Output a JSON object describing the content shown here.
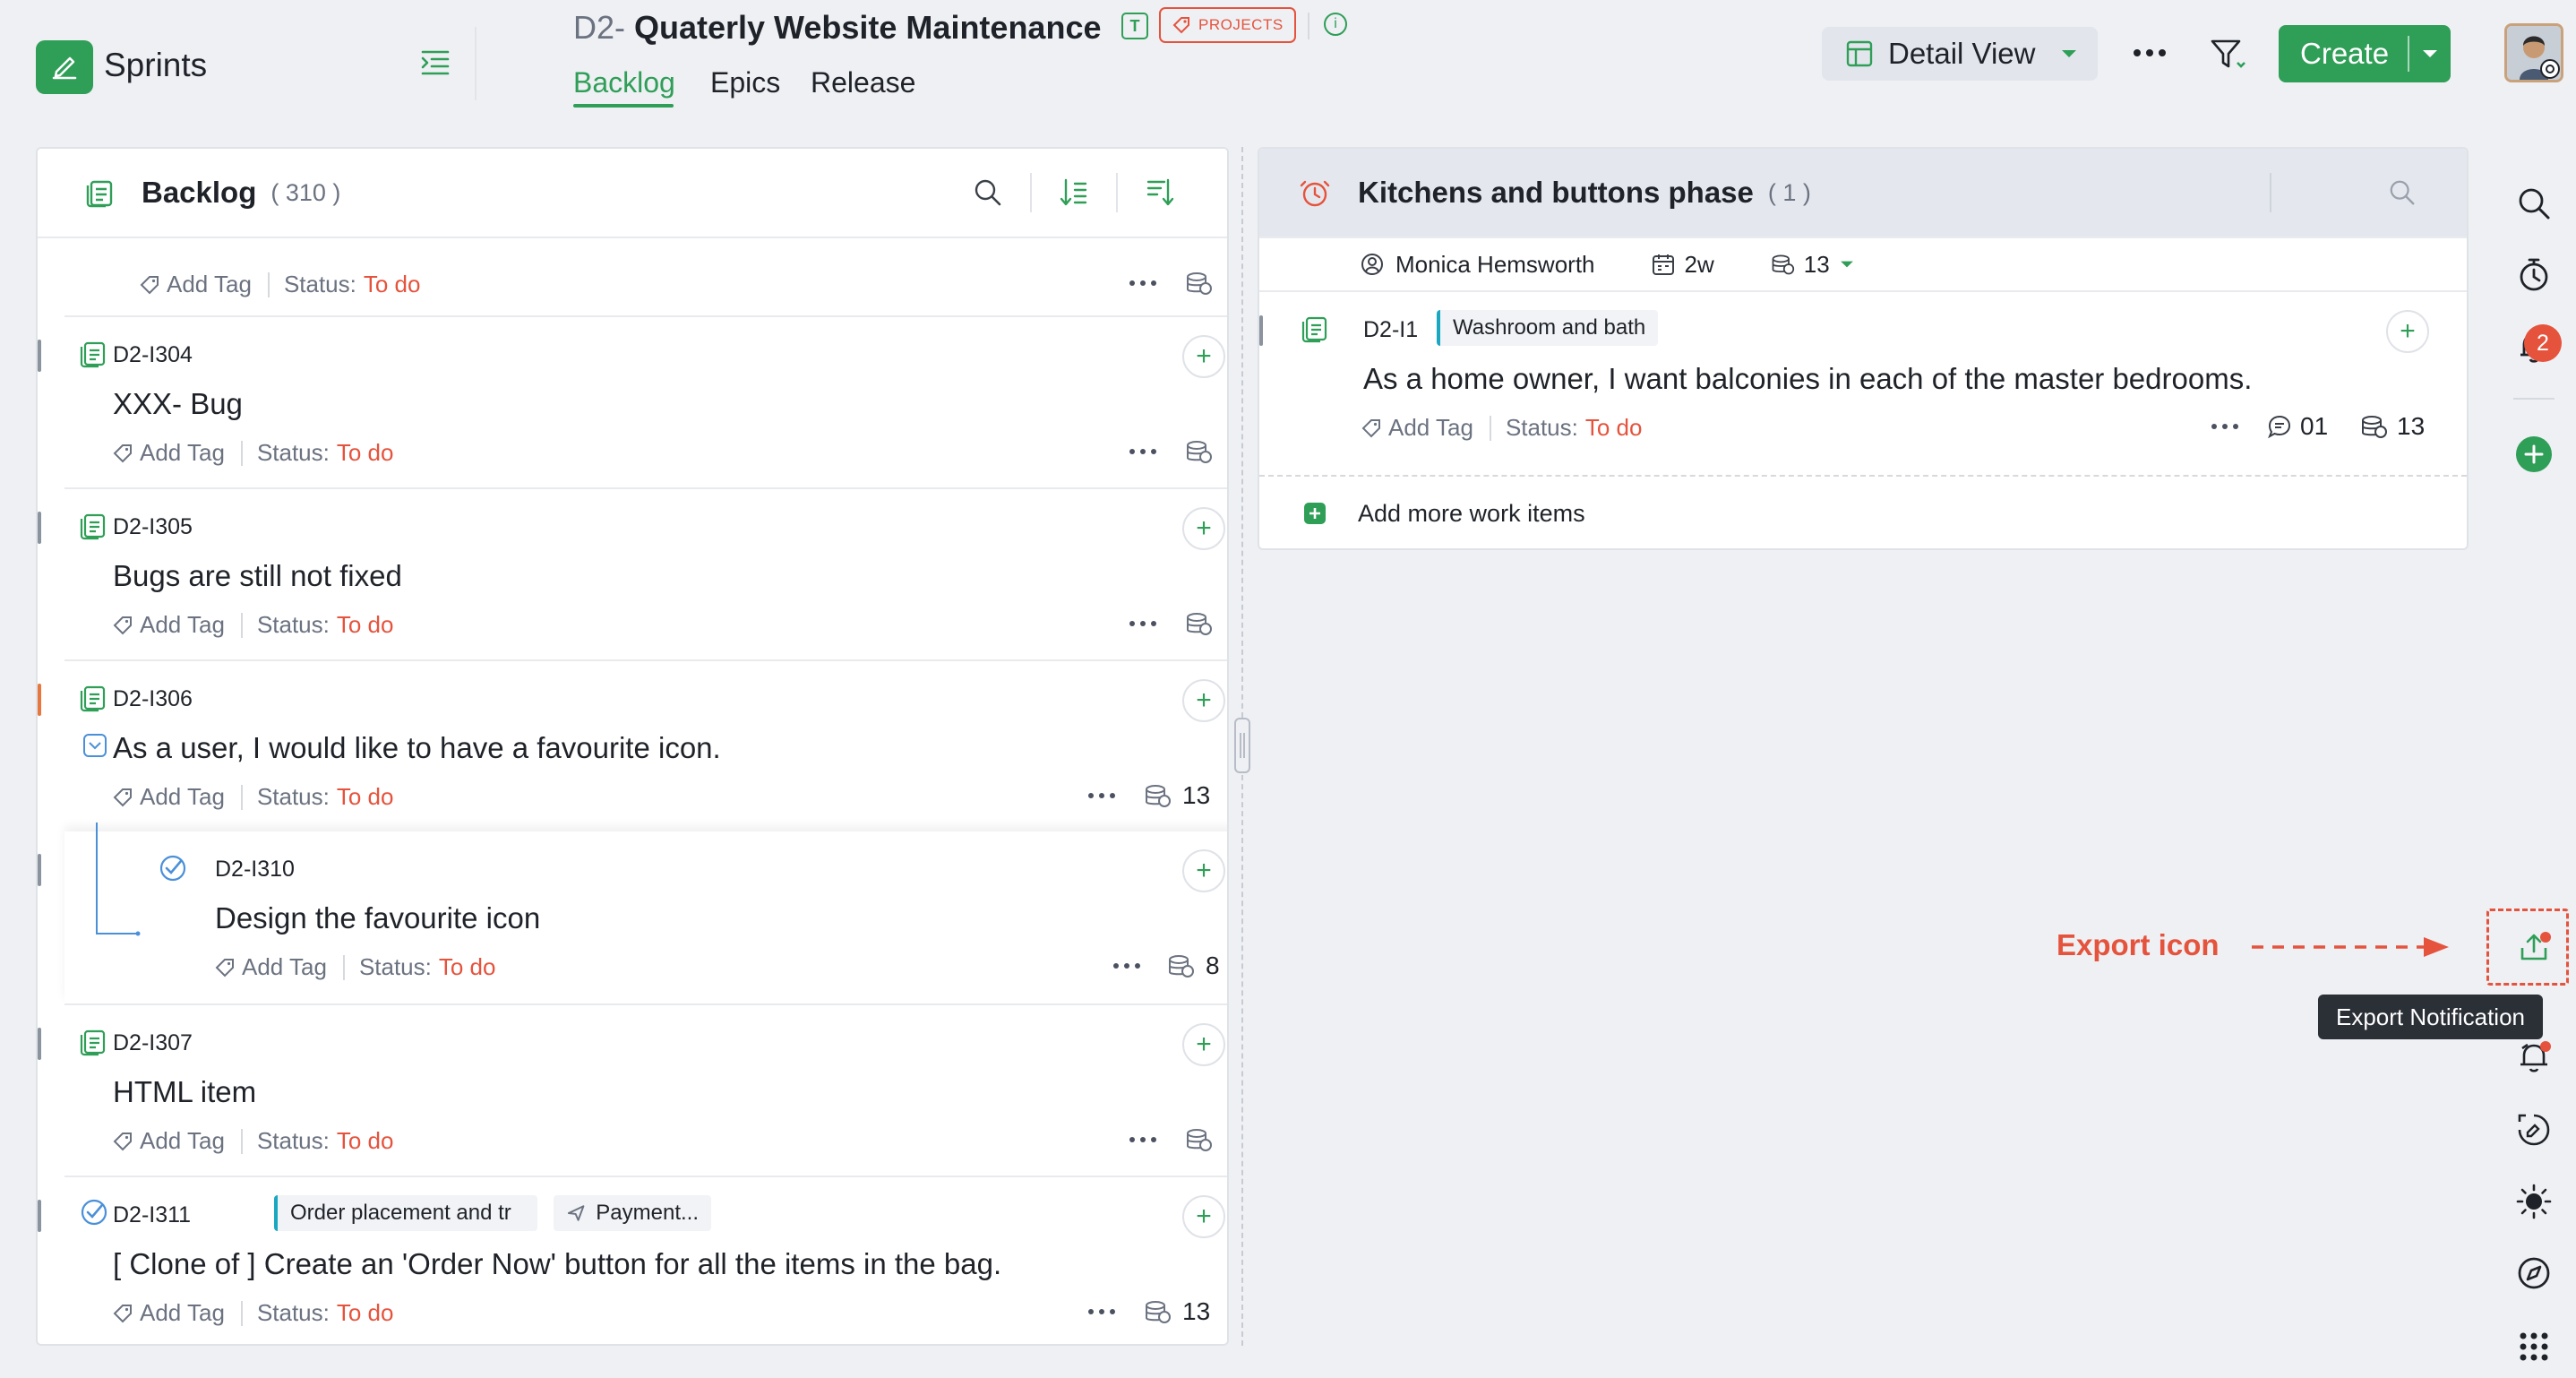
{
  "app": {
    "name": "Sprints"
  },
  "project": {
    "key": "D2-",
    "title": "Quaterly Website Maintenance",
    "type_letter": "T",
    "badge": "PROJECTS",
    "info_glyph": "i"
  },
  "tabs": [
    {
      "label": "Backlog",
      "active": true
    },
    {
      "label": "Epics",
      "active": false
    },
    {
      "label": "Release",
      "active": false
    }
  ],
  "toolbar": {
    "view_label": "Detail View",
    "create_label": "Create"
  },
  "backlog": {
    "title": "Backlog",
    "count": "( 310 )",
    "items": [
      {
        "id": "",
        "title": "",
        "tag_label": "Add Tag",
        "status_label": "Status:",
        "status": "To do",
        "points": ""
      },
      {
        "id": "D2-I304",
        "title": "XXX- Bug",
        "tag_label": "Add Tag",
        "status_label": "Status:",
        "status": "To do",
        "points": ""
      },
      {
        "id": "D2-I305",
        "title": "Bugs are still not fixed",
        "tag_label": "Add Tag",
        "status_label": "Status:",
        "status": "To do",
        "points": ""
      },
      {
        "id": "D2-I306",
        "title": "As a user, I would like to have a favourite icon.",
        "tag_label": "Add Tag",
        "status_label": "Status:",
        "status": "To do",
        "points": "13"
      },
      {
        "id": "D2-I310",
        "title": "Design the favourite icon",
        "tag_label": "Add Tag",
        "status_label": "Status:",
        "status": "To do",
        "points": "8"
      },
      {
        "id": "D2-I307",
        "title": "HTML item",
        "tag_label": "Add Tag",
        "status_label": "Status:",
        "status": "To do",
        "points": ""
      },
      {
        "id": "D2-I311",
        "title": "[ Clone of ] Create an 'Order Now' button for all the items in the bag.",
        "tag_label": "Add Tag",
        "status_label": "Status:",
        "status": "To do",
        "points": "13",
        "chips": [
          "Order placement and tr",
          "Payment..."
        ]
      }
    ]
  },
  "sprint": {
    "title": "Kitchens and buttons phase",
    "count": "( 1 )",
    "owner": "Monica Hemsworth",
    "duration": "2w",
    "points": "13",
    "item": {
      "id": "D2-I1",
      "chip": "Washroom and bath",
      "title": "As a home owner, I want balconies in each of the master bedrooms.",
      "tag_label": "Add Tag",
      "status_label": "Status:",
      "status": "To do",
      "comments": "01",
      "points": "13"
    },
    "add_more": "Add more work items"
  },
  "sidebar": {
    "notifications_count": "2",
    "icons": [
      "search-icon",
      "timer-icon",
      "bell-icon",
      "add-icon",
      "export-icon",
      "bell-alert-icon",
      "feedback-icon",
      "theme-icon",
      "compass-icon",
      "apps-grid-icon"
    ]
  },
  "annotation": {
    "label": "Export icon",
    "tooltip": "Export Notification"
  },
  "colors": {
    "brand": "#2f9e57",
    "status": "#e5533d",
    "annotation": "#e5533d"
  }
}
